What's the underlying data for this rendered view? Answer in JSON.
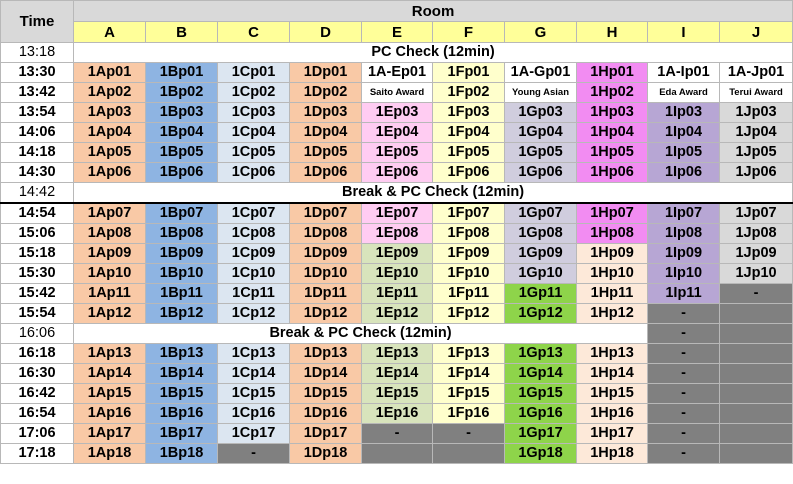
{
  "header": {
    "time_label": "Time",
    "room_label": "Room",
    "rooms": [
      "A",
      "B",
      "C",
      "D",
      "E",
      "F",
      "G",
      "H",
      "I",
      "J"
    ]
  },
  "rows": [
    {
      "time": "13:18",
      "merged": "PC Check (12min)"
    },
    {
      "time": "13:30",
      "cells": [
        {
          "t": "1Ap01",
          "c": "a"
        },
        {
          "t": "1Bp01",
          "c": "b"
        },
        {
          "t": "1Cp01",
          "c": "c"
        },
        {
          "t": "1Dp01",
          "c": "d"
        },
        {
          "t": "1A-Ep01",
          "c": "white",
          "award": true
        },
        {
          "t": "1Fp01",
          "c": "f"
        },
        {
          "t": "1A-Gp01",
          "c": "white",
          "award": true
        },
        {
          "t": "1Hp01",
          "c": "h"
        },
        {
          "t": "1A-Ip01",
          "c": "white",
          "award": true
        },
        {
          "t": "1A-Jp01",
          "c": "white",
          "award": true
        }
      ]
    },
    {
      "time": "13:42",
      "cells": [
        {
          "t": "1Ap02",
          "c": "a"
        },
        {
          "t": "1Bp02",
          "c": "b"
        },
        {
          "t": "1Cp02",
          "c": "c"
        },
        {
          "t": "1Dp02",
          "c": "d"
        },
        {
          "t": "Saito Award",
          "c": "white",
          "award": true,
          "small": true
        },
        {
          "t": "1Fp02",
          "c": "f"
        },
        {
          "t": "Young Asian",
          "c": "white",
          "award": true,
          "small": true
        },
        {
          "t": "1Hp02",
          "c": "h"
        },
        {
          "t": "Eda Award",
          "c": "white",
          "award": true,
          "small": true
        },
        {
          "t": "Terui Award",
          "c": "white",
          "award": true,
          "small": true
        }
      ]
    },
    {
      "time": "13:54",
      "cells": [
        {
          "t": "1Ap03",
          "c": "a"
        },
        {
          "t": "1Bp03",
          "c": "b"
        },
        {
          "t": "1Cp03",
          "c": "c"
        },
        {
          "t": "1Dp03",
          "c": "d"
        },
        {
          "t": "1Ep03",
          "c": "e"
        },
        {
          "t": "1Fp03",
          "c": "f"
        },
        {
          "t": "1Gp03",
          "c": "g"
        },
        {
          "t": "1Hp03",
          "c": "h"
        },
        {
          "t": "1Ip03",
          "c": "i"
        },
        {
          "t": "1Jp03",
          "c": "j"
        }
      ]
    },
    {
      "time": "14:06",
      "cells": [
        {
          "t": "1Ap04",
          "c": "a"
        },
        {
          "t": "1Bp04",
          "c": "b"
        },
        {
          "t": "1Cp04",
          "c": "c"
        },
        {
          "t": "1Dp04",
          "c": "d"
        },
        {
          "t": "1Ep04",
          "c": "e"
        },
        {
          "t": "1Fp04",
          "c": "f"
        },
        {
          "t": "1Gp04",
          "c": "g"
        },
        {
          "t": "1Hp04",
          "c": "h"
        },
        {
          "t": "1Ip04",
          "c": "i"
        },
        {
          "t": "1Jp04",
          "c": "j"
        }
      ]
    },
    {
      "time": "14:18",
      "cells": [
        {
          "t": "1Ap05",
          "c": "a"
        },
        {
          "t": "1Bp05",
          "c": "b"
        },
        {
          "t": "1Cp05",
          "c": "c"
        },
        {
          "t": "1Dp05",
          "c": "d"
        },
        {
          "t": "1Ep05",
          "c": "e"
        },
        {
          "t": "1Fp05",
          "c": "f"
        },
        {
          "t": "1Gp05",
          "c": "g"
        },
        {
          "t": "1Hp05",
          "c": "h"
        },
        {
          "t": "1Ip05",
          "c": "i"
        },
        {
          "t": "1Jp05",
          "c": "j"
        }
      ]
    },
    {
      "time": "14:30",
      "cells": [
        {
          "t": "1Ap06",
          "c": "a"
        },
        {
          "t": "1Bp06",
          "c": "b"
        },
        {
          "t": "1Cp06",
          "c": "c"
        },
        {
          "t": "1Dp06",
          "c": "d"
        },
        {
          "t": "1Ep06",
          "c": "e"
        },
        {
          "t": "1Fp06",
          "c": "f"
        },
        {
          "t": "1Gp06",
          "c": "g"
        },
        {
          "t": "1Hp06",
          "c": "h"
        },
        {
          "t": "1Ip06",
          "c": "i"
        },
        {
          "t": "1Jp06",
          "c": "j"
        }
      ]
    },
    {
      "time": "14:42",
      "merged": "Break & PC Check (12min)"
    },
    {
      "time": "14:54",
      "thick": true,
      "cells": [
        {
          "t": "1Ap07",
          "c": "a"
        },
        {
          "t": "1Bp07",
          "c": "b"
        },
        {
          "t": "1Cp07",
          "c": "c"
        },
        {
          "t": "1Dp07",
          "c": "d"
        },
        {
          "t": "1Ep07",
          "c": "e"
        },
        {
          "t": "1Fp07",
          "c": "f"
        },
        {
          "t": "1Gp07",
          "c": "g"
        },
        {
          "t": "1Hp07",
          "c": "h"
        },
        {
          "t": "1Ip07",
          "c": "i"
        },
        {
          "t": "1Jp07",
          "c": "j"
        }
      ]
    },
    {
      "time": "15:06",
      "cells": [
        {
          "t": "1Ap08",
          "c": "a"
        },
        {
          "t": "1Bp08",
          "c": "b"
        },
        {
          "t": "1Cp08",
          "c": "c"
        },
        {
          "t": "1Dp08",
          "c": "d"
        },
        {
          "t": "1Ep08",
          "c": "e"
        },
        {
          "t": "1Fp08",
          "c": "f"
        },
        {
          "t": "1Gp08",
          "c": "g"
        },
        {
          "t": "1Hp08",
          "c": "h"
        },
        {
          "t": "1Ip08",
          "c": "i"
        },
        {
          "t": "1Jp08",
          "c": "j"
        }
      ]
    },
    {
      "time": "15:18",
      "cells": [
        {
          "t": "1Ap09",
          "c": "a"
        },
        {
          "t": "1Bp09",
          "c": "b"
        },
        {
          "t": "1Cp09",
          "c": "c"
        },
        {
          "t": "1Dp09",
          "c": "d"
        },
        {
          "t": "1Ep09",
          "c": "e2"
        },
        {
          "t": "1Fp09",
          "c": "f"
        },
        {
          "t": "1Gp09",
          "c": "g"
        },
        {
          "t": "1Hp09",
          "c": "h2"
        },
        {
          "t": "1Ip09",
          "c": "i"
        },
        {
          "t": "1Jp09",
          "c": "j"
        }
      ]
    },
    {
      "time": "15:30",
      "cells": [
        {
          "t": "1Ap10",
          "c": "a"
        },
        {
          "t": "1Bp10",
          "c": "b"
        },
        {
          "t": "1Cp10",
          "c": "c"
        },
        {
          "t": "1Dp10",
          "c": "d"
        },
        {
          "t": "1Ep10",
          "c": "e2"
        },
        {
          "t": "1Fp10",
          "c": "f"
        },
        {
          "t": "1Gp10",
          "c": "g"
        },
        {
          "t": "1Hp10",
          "c": "h2"
        },
        {
          "t": "1Ip10",
          "c": "i"
        },
        {
          "t": "1Jp10",
          "c": "j"
        }
      ]
    },
    {
      "time": "15:42",
      "cells": [
        {
          "t": "1Ap11",
          "c": "a"
        },
        {
          "t": "1Bp11",
          "c": "b"
        },
        {
          "t": "1Cp11",
          "c": "c"
        },
        {
          "t": "1Dp11",
          "c": "d"
        },
        {
          "t": "1Ep11",
          "c": "e2"
        },
        {
          "t": "1Fp11",
          "c": "f"
        },
        {
          "t": "1Gp11",
          "c": "g2"
        },
        {
          "t": "1Hp11",
          "c": "h2"
        },
        {
          "t": "1Ip11",
          "c": "i"
        },
        {
          "t": "-",
          "c": "gray",
          "dash": true
        }
      ]
    },
    {
      "time": "15:54",
      "cells": [
        {
          "t": "1Ap12",
          "c": "a"
        },
        {
          "t": "1Bp12",
          "c": "b"
        },
        {
          "t": "1Cp12",
          "c": "c"
        },
        {
          "t": "1Dp12",
          "c": "d"
        },
        {
          "t": "1Ep12",
          "c": "e2"
        },
        {
          "t": "1Fp12",
          "c": "f"
        },
        {
          "t": "1Gp12",
          "c": "g2"
        },
        {
          "t": "1Hp12",
          "c": "h2"
        },
        {
          "t": "-",
          "c": "gray",
          "dash": true
        },
        {
          "t": "",
          "c": "gray"
        }
      ]
    },
    {
      "time": "16:06",
      "merged": "Break & PC Check (12min)",
      "tail": [
        {
          "t": "-",
          "c": "gray",
          "dash": true
        },
        {
          "t": "",
          "c": "gray"
        }
      ]
    },
    {
      "time": "16:18",
      "cells": [
        {
          "t": "1Ap13",
          "c": "a"
        },
        {
          "t": "1Bp13",
          "c": "b"
        },
        {
          "t": "1Cp13",
          "c": "c"
        },
        {
          "t": "1Dp13",
          "c": "d"
        },
        {
          "t": "1Ep13",
          "c": "e2"
        },
        {
          "t": "1Fp13",
          "c": "f"
        },
        {
          "t": "1Gp13",
          "c": "g2"
        },
        {
          "t": "1Hp13",
          "c": "h2"
        },
        {
          "t": "-",
          "c": "gray",
          "dash": true
        },
        {
          "t": "",
          "c": "gray"
        }
      ]
    },
    {
      "time": "16:30",
      "cells": [
        {
          "t": "1Ap14",
          "c": "a"
        },
        {
          "t": "1Bp14",
          "c": "b"
        },
        {
          "t": "1Cp14",
          "c": "c"
        },
        {
          "t": "1Dp14",
          "c": "d"
        },
        {
          "t": "1Ep14",
          "c": "e2"
        },
        {
          "t": "1Fp14",
          "c": "f"
        },
        {
          "t": "1Gp14",
          "c": "g2"
        },
        {
          "t": "1Hp14",
          "c": "h2"
        },
        {
          "t": "-",
          "c": "gray",
          "dash": true
        },
        {
          "t": "",
          "c": "gray"
        }
      ]
    },
    {
      "time": "16:42",
      "cells": [
        {
          "t": "1Ap15",
          "c": "a"
        },
        {
          "t": "1Bp15",
          "c": "b"
        },
        {
          "t": "1Cp15",
          "c": "c"
        },
        {
          "t": "1Dp15",
          "c": "d"
        },
        {
          "t": "1Ep15",
          "c": "e2"
        },
        {
          "t": "1Fp15",
          "c": "f"
        },
        {
          "t": "1Gp15",
          "c": "g2"
        },
        {
          "t": "1Hp15",
          "c": "h2"
        },
        {
          "t": "-",
          "c": "gray",
          "dash": true
        },
        {
          "t": "",
          "c": "gray"
        }
      ]
    },
    {
      "time": "16:54",
      "cells": [
        {
          "t": "1Ap16",
          "c": "a"
        },
        {
          "t": "1Bp16",
          "c": "b"
        },
        {
          "t": "1Cp16",
          "c": "c"
        },
        {
          "t": "1Dp16",
          "c": "d"
        },
        {
          "t": "1Ep16",
          "c": "e2"
        },
        {
          "t": "1Fp16",
          "c": "f"
        },
        {
          "t": "1Gp16",
          "c": "g2"
        },
        {
          "t": "1Hp16",
          "c": "h2"
        },
        {
          "t": "-",
          "c": "gray",
          "dash": true
        },
        {
          "t": "",
          "c": "gray"
        }
      ]
    },
    {
      "time": "17:06",
      "cells": [
        {
          "t": "1Ap17",
          "c": "a"
        },
        {
          "t": "1Bp17",
          "c": "b"
        },
        {
          "t": "1Cp17",
          "c": "c"
        },
        {
          "t": "1Dp17",
          "c": "d"
        },
        {
          "t": "-",
          "c": "gray",
          "dash": true
        },
        {
          "t": "-",
          "c": "gray",
          "dash": true
        },
        {
          "t": "1Gp17",
          "c": "g2"
        },
        {
          "t": "1Hp17",
          "c": "h2"
        },
        {
          "t": "-",
          "c": "gray",
          "dash": true
        },
        {
          "t": "",
          "c": "gray"
        }
      ]
    },
    {
      "time": "17:18",
      "cells": [
        {
          "t": "1Ap18",
          "c": "a"
        },
        {
          "t": "1Bp18",
          "c": "b"
        },
        {
          "t": "-",
          "c": "gray",
          "dash": true
        },
        {
          "t": "1Dp18",
          "c": "d"
        },
        {
          "t": "",
          "c": "gray"
        },
        {
          "t": "",
          "c": "gray"
        },
        {
          "t": "1Gp18",
          "c": "g2"
        },
        {
          "t": "1Hp18",
          "c": "h2"
        },
        {
          "t": "-",
          "c": "gray",
          "dash": true
        },
        {
          "t": "",
          "c": "gray"
        }
      ]
    }
  ]
}
